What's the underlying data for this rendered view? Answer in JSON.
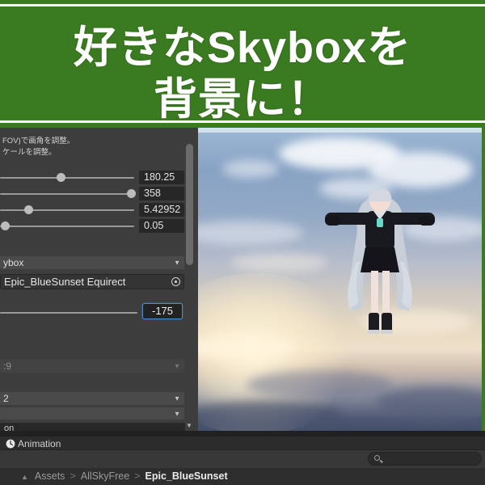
{
  "banner": {
    "title_line1": "好きなSkyboxを",
    "title_line2": "背景に！",
    "bg_color": "#3a7a20",
    "text_color": "#ffffff"
  },
  "inspector": {
    "help_line1": "FOV)で画角を調整。",
    "help_line2": "ケールを調整。",
    "sliders": [
      {
        "value": "180.25"
      },
      {
        "value": "358"
      },
      {
        "value": "5.42952"
      },
      {
        "value": "0.05"
      }
    ],
    "skybox_dropdown_label": "ybox",
    "texture_field_value": "Epic_BlueSunset Equirect",
    "rotation_value": "-175",
    "dropdown_disabled_label": ":9",
    "dropdown_b_label": "2",
    "dropdown_c_label": "",
    "partial_row_label": "on"
  },
  "animation_bar": {
    "label": "Animation"
  },
  "footer": {
    "breadcrumb": {
      "root": "Assets",
      "middle": "AllSkyFree",
      "current": "Epic_BlueSunset",
      "separator": ">"
    },
    "search_placeholder": ""
  },
  "colors": {
    "banner_green": "#3a7a20",
    "focus_blue": "#4f8cc9",
    "panel_bg": "#3d3d3d",
    "accent_teal": "#66d9c8"
  }
}
